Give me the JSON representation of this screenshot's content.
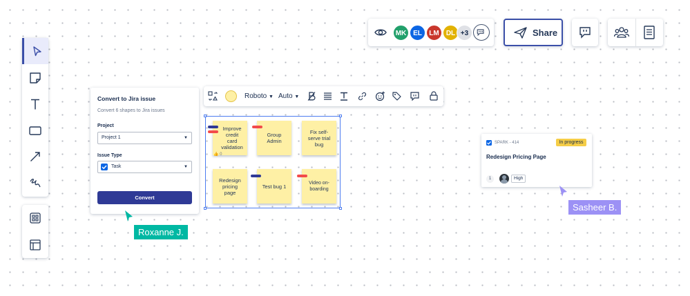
{
  "collaborators": {
    "avatars": [
      {
        "initials": "MK",
        "color": "#22a06b"
      },
      {
        "initials": "EL",
        "color": "#0c66e4"
      },
      {
        "initials": "LM",
        "color": "#c9372c"
      },
      {
        "initials": "DL",
        "color": "#e2b203"
      }
    ],
    "overflow": "+3"
  },
  "share": {
    "label": "Share"
  },
  "jira_panel": {
    "title": "Convert to Jira issue",
    "subtitle": "Convert 6 shapes to Jira issues",
    "project_label": "Project",
    "project_value": "Project 1",
    "issue_type_label": "Issue Type",
    "issue_type_value": "Task",
    "convert_label": "Convert"
  },
  "format_toolbar": {
    "fill_color": "#fef0a5",
    "font": "Roboto",
    "size": "Auto"
  },
  "stickies": [
    {
      "text": "Improve credit card validation",
      "tags": [
        "#2f3a96",
        "#f24b4b"
      ],
      "reaction": "👍 0"
    },
    {
      "text": "Group Admin",
      "tags": [
        "#f24b4b"
      ]
    },
    {
      "text": "Fix self-serve trial bug",
      "tags": []
    },
    {
      "text": "Redesign pricing page",
      "tags": []
    },
    {
      "text": "Test bug 1",
      "tags": [
        "#2f3a96",
        "#f24b4b"
      ]
    },
    {
      "text": "Video on-boarding",
      "tags": [
        "#f24b4b"
      ]
    }
  ],
  "jira_card": {
    "key": "SPARK - 414",
    "status": "In progress",
    "title": "Redesign Pricing Page",
    "comments": "1",
    "priority": "High"
  },
  "cursors": {
    "roxanne": {
      "name": "Roxanne J.",
      "color": "#00b8a3"
    },
    "sasheer": {
      "name": "Sasheer B.",
      "color": "#9c91f5"
    }
  }
}
